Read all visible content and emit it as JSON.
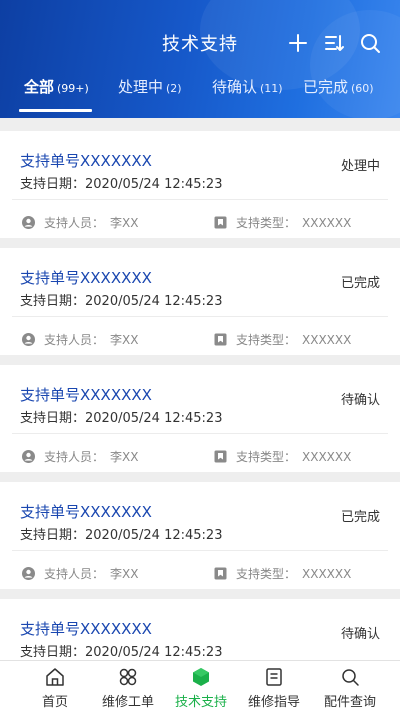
{
  "header": {
    "title": "技术支持",
    "icons": [
      "plus-icon",
      "filter-sort-icon",
      "search-icon"
    ]
  },
  "tabs": [
    {
      "label": "全部",
      "count": "(99+)"
    },
    {
      "label": "处理中",
      "count": "(2)"
    },
    {
      "label": "待确认",
      "count": "(11)"
    },
    {
      "label": "已完成",
      "count": "(60)"
    }
  ],
  "cards": [
    {
      "number": "支持单号XXXXXXX",
      "date_label": "支持日期：",
      "date": "2020/05/24 12:45:23",
      "status": "处理中",
      "person_label": "支持人员：",
      "person": "李XX",
      "type_label": "支持类型：",
      "type": "XXXXXX"
    },
    {
      "number": "支持单号XXXXXXX",
      "date_label": "支持日期：",
      "date": "2020/05/24 12:45:23",
      "status": "已完成",
      "person_label": "支持人员：",
      "person": "李XX",
      "type_label": "支持类型：",
      "type": "XXXXXX"
    },
    {
      "number": "支持单号XXXXXXX",
      "date_label": "支持日期：",
      "date": "2020/05/24 12:45:23",
      "status": "待确认",
      "person_label": "支持人员：",
      "person": "李XX",
      "type_label": "支持类型：",
      "type": "XXXXXX"
    },
    {
      "number": "支持单号XXXXXXX",
      "date_label": "支持日期：",
      "date": "2020/05/24 12:45:23",
      "status": "已完成",
      "person_label": "支持人员：",
      "person": "李XX",
      "type_label": "支持类型：",
      "type": "XXXXXX"
    },
    {
      "number": "支持单号XXXXXXX",
      "date_label": "支持日期：",
      "date": "2020/05/24 12:45:23",
      "status": "待确认"
    }
  ],
  "bottom_nav": [
    {
      "label": "首页",
      "icon": "home-icon"
    },
    {
      "label": "维修工单",
      "icon": "grid-icon"
    },
    {
      "label": "技术支持",
      "icon": "support-icon",
      "active": true
    },
    {
      "label": "维修指导",
      "icon": "guide-icon"
    },
    {
      "label": "配件查询",
      "icon": "parts-icon"
    }
  ],
  "colors": {
    "header_start": "#0d3fa3",
    "header_end": "#3a86ee",
    "order_number": "#1a47b0",
    "active_nav": "#1bb04a"
  }
}
